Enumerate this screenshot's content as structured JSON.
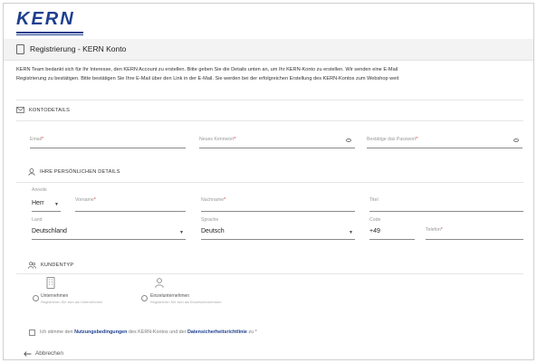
{
  "brand": {
    "logo_text": "KERN"
  },
  "header": {
    "title": "Registrierung - KERN Konto"
  },
  "intro": {
    "line1": "KERN Team bedankt sich für Ihr Interesse, den KERN Account zu erstellen. Bitte geben Sie die Details unten an, um Ihr KERN-Konto zu erstellen. Wir senden eine E-Mail",
    "line2": "Registrierung zu bestätigen. Bitte bestätigen Sie Ihre E-Mail über den Link in der E-Mail. Sie werden bei der erfolgreichen Erstellung des KERN-Kontos zum Webshop weit"
  },
  "account": {
    "heading": "KONTODETAILS",
    "email_label": "Email",
    "password_label": "Neues Kennwort",
    "confirm_label": "Bestätige das Passwort",
    "required_mark": "*"
  },
  "personal": {
    "heading": "IHRE PERSÖNLICHEN DETAILS",
    "salutation_label": "Anrede",
    "salutation_value": "Herr",
    "firstname_label": "Vorname",
    "lastname_label": "Nachname",
    "title_label": "Titel",
    "country_label": "Land",
    "country_value": "Deutschland",
    "language_label": "Sprache",
    "language_value": "Deutsch",
    "code_label": "Code",
    "code_value": "+49",
    "phone_label": "Telefon"
  },
  "customer_type": {
    "heading": "KUNDENTYP",
    "company_label": "Unternehmen",
    "company_sub": "Registrieren Sie sich als Unternehmen",
    "sole_label": "Einzelunternehmen",
    "sole_sub": "Registrieren Sie sich als Einzelunternehmen"
  },
  "terms": {
    "prefix": "Ich stimme den ",
    "link1": "Nutzungsbedingungen",
    "middle": " des KERN-Kontos und der ",
    "link2": "Datensicherheitsrichtlinie",
    "suffix": " zu *"
  },
  "actions": {
    "cancel_label": "Abbrechen"
  },
  "colors": {
    "brand": "#1d3f8f",
    "required": "#d33333"
  }
}
